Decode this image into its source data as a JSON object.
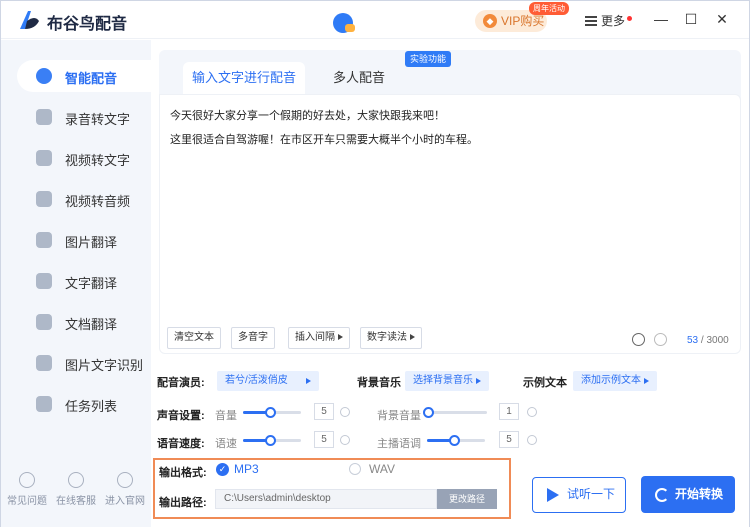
{
  "app": {
    "title": "布谷鸟配音"
  },
  "header": {
    "vip_label": "VIP购买",
    "vip_badge": "周年活动",
    "more_label": "更多"
  },
  "sidebar": {
    "items": [
      {
        "label": "智能配音",
        "active": true
      },
      {
        "label": "录音转文字"
      },
      {
        "label": "视频转文字"
      },
      {
        "label": "视频转音频"
      },
      {
        "label": "图片翻译"
      },
      {
        "label": "文字翻译"
      },
      {
        "label": "文档翻译"
      },
      {
        "label": "图片文字识别"
      },
      {
        "label": "任务列表"
      }
    ],
    "bottom_links": [
      "常见问题",
      "在线客服",
      "进入官网"
    ]
  },
  "tabs": [
    {
      "label": "输入文字进行配音",
      "active": true
    },
    {
      "label": "多人配音"
    }
  ],
  "lab_badge": "实验功能",
  "editor": {
    "lines": [
      "今天很好大家分享一个假期的好去处，大家快跟我来吧！",
      "这里很适合自驾游喔！在市区开车只需要大概半个小时的车程。"
    ]
  },
  "toolbar": {
    "clear": "清空文本",
    "polyphone": "多音字",
    "insert_pause": "插入间隔",
    "number_reading": "数字读法",
    "count_current": "53",
    "count_sep": "/",
    "count_max": "3000"
  },
  "settings": {
    "voice_label": "配音演员:",
    "voice_value": "若兮/活泼俏皮",
    "bgm_label": "背景音乐",
    "bgm_value": "选择背景音乐",
    "sample_label": "示例文本",
    "sample_value": "添加示例文本",
    "sound_label": "声音设置:",
    "volume_label": "音量",
    "volume_value": "5",
    "bg_volume_label": "背景音量",
    "bg_volume_value": "1",
    "speed_row_label": "语音速度:",
    "speed_label": "语速",
    "speed_value": "5",
    "pitch_label": "主播语调",
    "pitch_value": "5"
  },
  "output": {
    "format_label": "输出格式:",
    "format_mp3": "MP3",
    "format_wav": "WAV",
    "path_label": "输出路径:",
    "path_value": "C:\\Users\\admin\\desktop",
    "change_path": "更改路径"
  },
  "actions": {
    "listen": "试听一下",
    "start": "开始转换"
  },
  "colors": {
    "accent": "#2c6ff2",
    "highlight_border": "#f08b56",
    "vip": "#d9752c"
  }
}
